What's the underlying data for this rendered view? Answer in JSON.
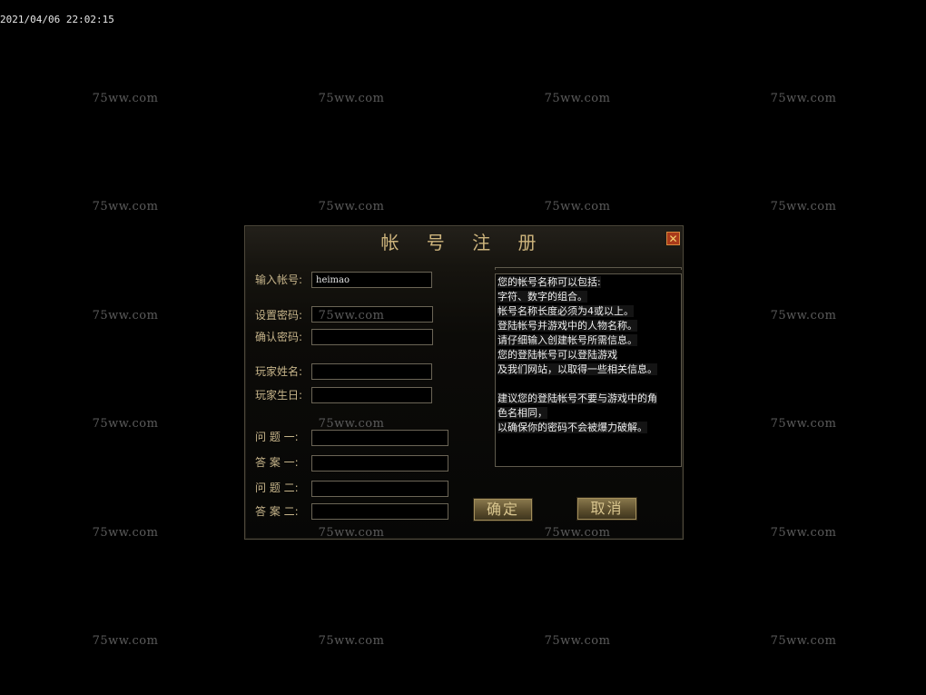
{
  "timestamp": "2021/04/06 22:02:15",
  "watermark": "75ww.com",
  "dialog": {
    "title": "帐 号 注 册",
    "close_symbol": "✕",
    "fields": {
      "account": {
        "label": "输入帐号:",
        "value": "heimao"
      },
      "password": {
        "label": "设置密码:",
        "value": ""
      },
      "confirm_password": {
        "label": "确认密码:",
        "value": ""
      },
      "player_name": {
        "label": "玩家姓名:",
        "value": ""
      },
      "player_birthday": {
        "label": "玩家生日:",
        "value": ""
      },
      "question1": {
        "label": "问 题 一:",
        "value": ""
      },
      "answer1": {
        "label": "答 案 一:",
        "value": ""
      },
      "question2": {
        "label": "问 题 二:",
        "value": ""
      },
      "answer2": {
        "label": "答 案 二:",
        "value": ""
      }
    },
    "info_lines": [
      "您的帐号名称可以包括:",
      "字符、数字的组合。",
      "帐号名称长度必须为4或以上。",
      "登陆帐号并游戏中的人物名称。",
      "请仔细输入创建帐号所需信息。",
      "您的登陆帐号可以登陆游戏",
      "及我们网站，以取得一些相关信息。",
      "",
      "建议您的登陆帐号不要与游戏中的角",
      "色名相同，",
      "以确保你的密码不会被爆力破解。"
    ],
    "ok_label": "确定",
    "cancel_label": "取消"
  },
  "colors": {
    "background": "#000000",
    "title_gold": "#cdb47c",
    "label_gold": "#c6b48a",
    "close_red": "#a93a1a"
  }
}
